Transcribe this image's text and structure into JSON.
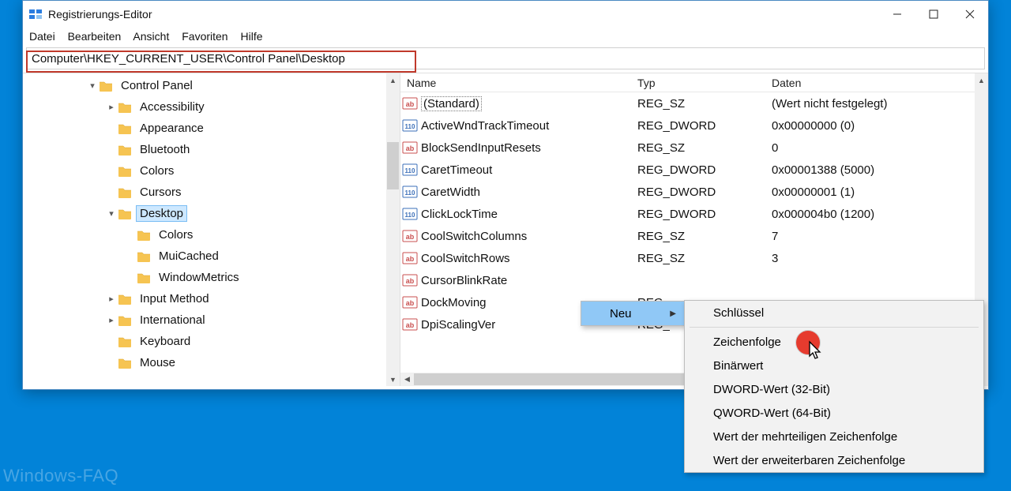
{
  "window": {
    "title": "Registrierungs-Editor",
    "menu": [
      "Datei",
      "Bearbeiten",
      "Ansicht",
      "Favoriten",
      "Hilfe"
    ],
    "address": "Computer\\HKEY_CURRENT_USER\\Control Panel\\Desktop"
  },
  "tree": {
    "items": [
      {
        "depth": 0,
        "twisty": "down",
        "label": "Control Panel",
        "selected": false
      },
      {
        "depth": 1,
        "twisty": "right",
        "label": "Accessibility"
      },
      {
        "depth": 1,
        "twisty": "",
        "label": "Appearance"
      },
      {
        "depth": 1,
        "twisty": "",
        "label": "Bluetooth"
      },
      {
        "depth": 1,
        "twisty": "",
        "label": "Colors"
      },
      {
        "depth": 1,
        "twisty": "",
        "label": "Cursors"
      },
      {
        "depth": 1,
        "twisty": "down",
        "label": "Desktop",
        "selected": true
      },
      {
        "depth": 2,
        "twisty": "",
        "label": "Colors"
      },
      {
        "depth": 2,
        "twisty": "",
        "label": "MuiCached"
      },
      {
        "depth": 2,
        "twisty": "",
        "label": "WindowMetrics"
      },
      {
        "depth": 1,
        "twisty": "right",
        "label": "Input Method"
      },
      {
        "depth": 1,
        "twisty": "right",
        "label": "International"
      },
      {
        "depth": 1,
        "twisty": "",
        "label": "Keyboard"
      },
      {
        "depth": 1,
        "twisty": "",
        "label": "Mouse"
      }
    ]
  },
  "list": {
    "headers": {
      "name": "Name",
      "type": "Typ",
      "data": "Daten"
    },
    "rows": [
      {
        "icon": "sz",
        "name": "(Standard)",
        "type": "REG_SZ",
        "data": "(Wert nicht festgelegt)",
        "default": true
      },
      {
        "icon": "dw",
        "name": "ActiveWndTrackTimeout",
        "type": "REG_DWORD",
        "data": "0x00000000 (0)"
      },
      {
        "icon": "sz",
        "name": "BlockSendInputResets",
        "type": "REG_SZ",
        "data": "0"
      },
      {
        "icon": "dw",
        "name": "CaretTimeout",
        "type": "REG_DWORD",
        "data": "0x00001388 (5000)"
      },
      {
        "icon": "dw",
        "name": "CaretWidth",
        "type": "REG_DWORD",
        "data": "0x00000001 (1)"
      },
      {
        "icon": "dw",
        "name": "ClickLockTime",
        "type": "REG_DWORD",
        "data": "0x000004b0 (1200)"
      },
      {
        "icon": "sz",
        "name": "CoolSwitchColumns",
        "type": "REG_SZ",
        "data": "7"
      },
      {
        "icon": "sz",
        "name": "CoolSwitchRows",
        "type": "REG_SZ",
        "data": "3"
      },
      {
        "icon": "sz",
        "name": "CursorBlinkRate",
        "type": "",
        "data": ""
      },
      {
        "icon": "sz",
        "name": "DockMoving",
        "type": "REG_",
        "data": ""
      },
      {
        "icon": "sz",
        "name": "DpiScalingVer",
        "type": "REG_",
        "data": ""
      }
    ]
  },
  "context": {
    "parent": {
      "label": "Neu"
    },
    "child": [
      "Schlüssel",
      "Zeichenfolge",
      "Binärwert",
      "DWORD-Wert (32-Bit)",
      "QWORD-Wert (64-Bit)",
      "Wert der mehrteiligen Zeichenfolge",
      "Wert der erweiterbaren Zeichenfolge"
    ]
  },
  "watermark": "Windows-FAQ"
}
